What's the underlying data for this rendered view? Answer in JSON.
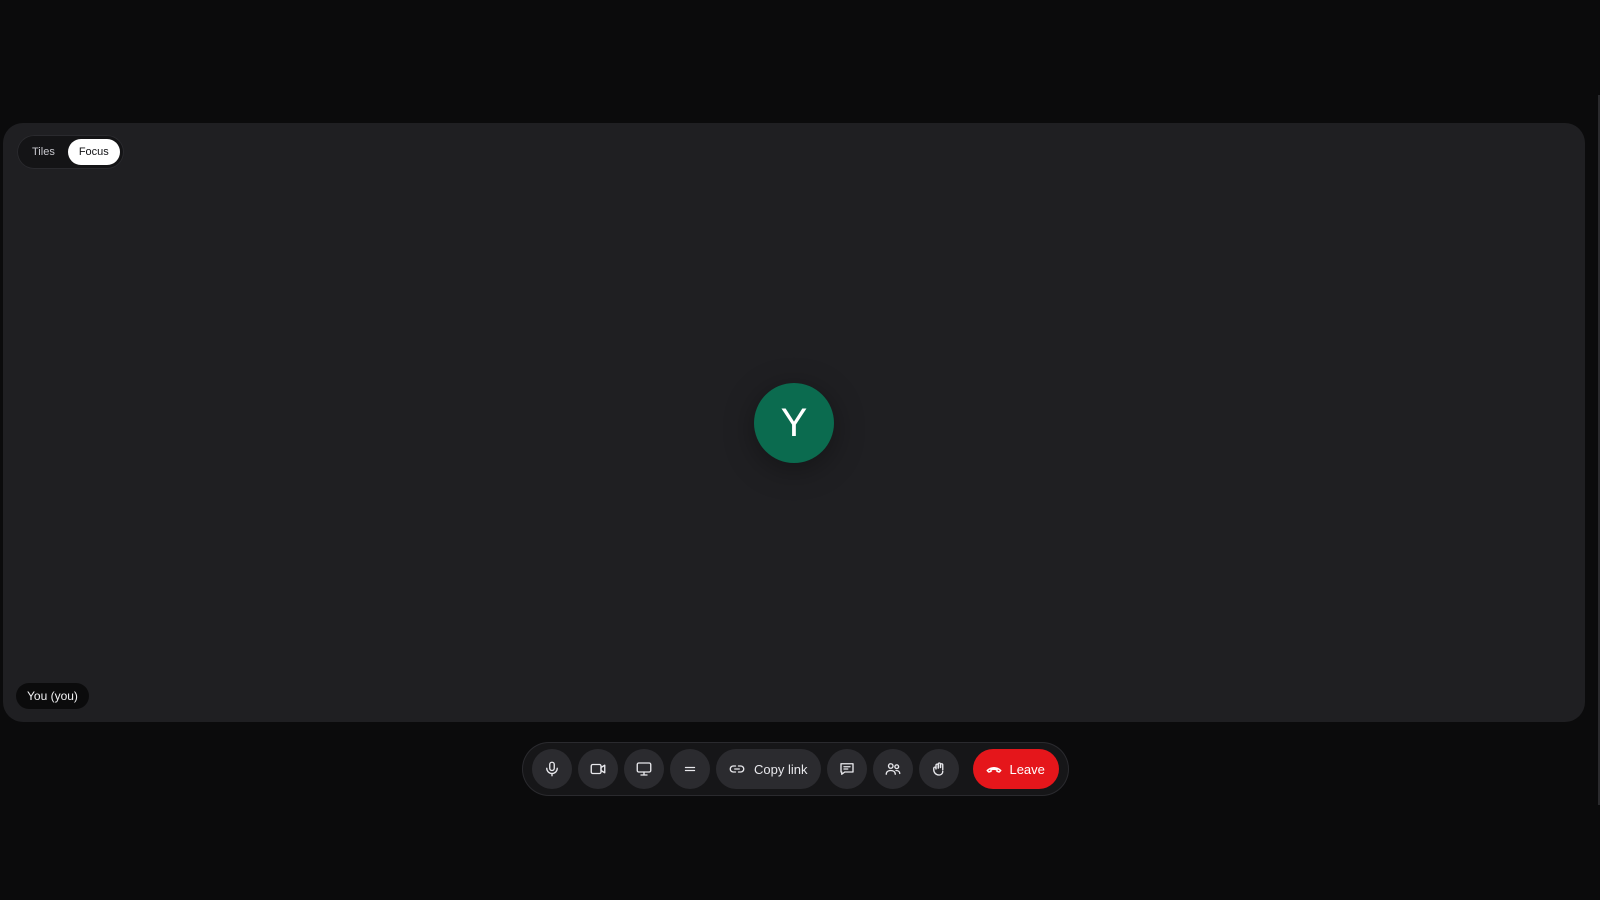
{
  "layout_toggle": {
    "options": [
      "Tiles",
      "Focus"
    ],
    "selected": "Focus"
  },
  "participant": {
    "initial": "Y",
    "name_label": "You (you)",
    "avatar_color": "#0b6b4f"
  },
  "toolbar": {
    "buttons": [
      {
        "icon": "microphone-icon"
      },
      {
        "icon": "camera-icon"
      },
      {
        "icon": "screen-share-icon"
      },
      {
        "icon": "menu-icon"
      },
      {
        "icon": "link-icon",
        "label": "Copy link"
      },
      {
        "icon": "chat-icon"
      },
      {
        "icon": "participants-icon"
      },
      {
        "icon": "raise-hand-icon"
      }
    ],
    "copy_link_label": "Copy link",
    "leave_label": "Leave",
    "leave_color": "#e5161b"
  }
}
